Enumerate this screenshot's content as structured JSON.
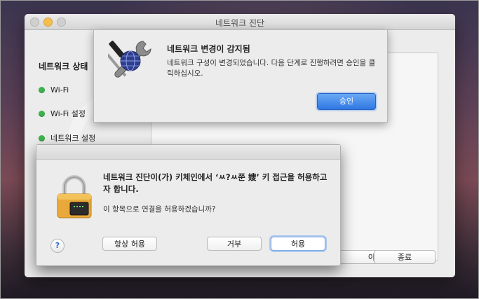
{
  "window": {
    "title": "네트워크 진단"
  },
  "sidebar": {
    "title": "네트워크 상태",
    "items": [
      {
        "label": "Wi-Fi",
        "status_color": "#3bb34a"
      },
      {
        "label": "Wi-Fi 설정",
        "status_color": "#3bb34a"
      },
      {
        "label": "네트워크 설정",
        "status_color": "#3bb34a"
      }
    ]
  },
  "footer_buttons": {
    "move_label": "이동",
    "quit_label": "종료"
  },
  "change_sheet": {
    "title": "네트워크 변경이 감지됨",
    "message": "네트워크 구성이 변경되었습니다. 다음 단계로 진행하려면 승인을 클릭하십시오.",
    "approve_label": "승인",
    "icon": "network-utility-tools-icon"
  },
  "keychain_dialog": {
    "title": "네트워크 진단이(가) 키체인에서 ‘ㅆ?ㅆ쭌 嫂’ 키 접근을 허용하고자 합니다.",
    "message": "이 항목으로 연결을 허용하겠습니까?",
    "help_label": "?",
    "always_allow_label": "항상 허용",
    "deny_label": "거부",
    "allow_label": "허용",
    "icon": "keychain-lock-icon",
    "accent_color": "#2f78e3"
  }
}
